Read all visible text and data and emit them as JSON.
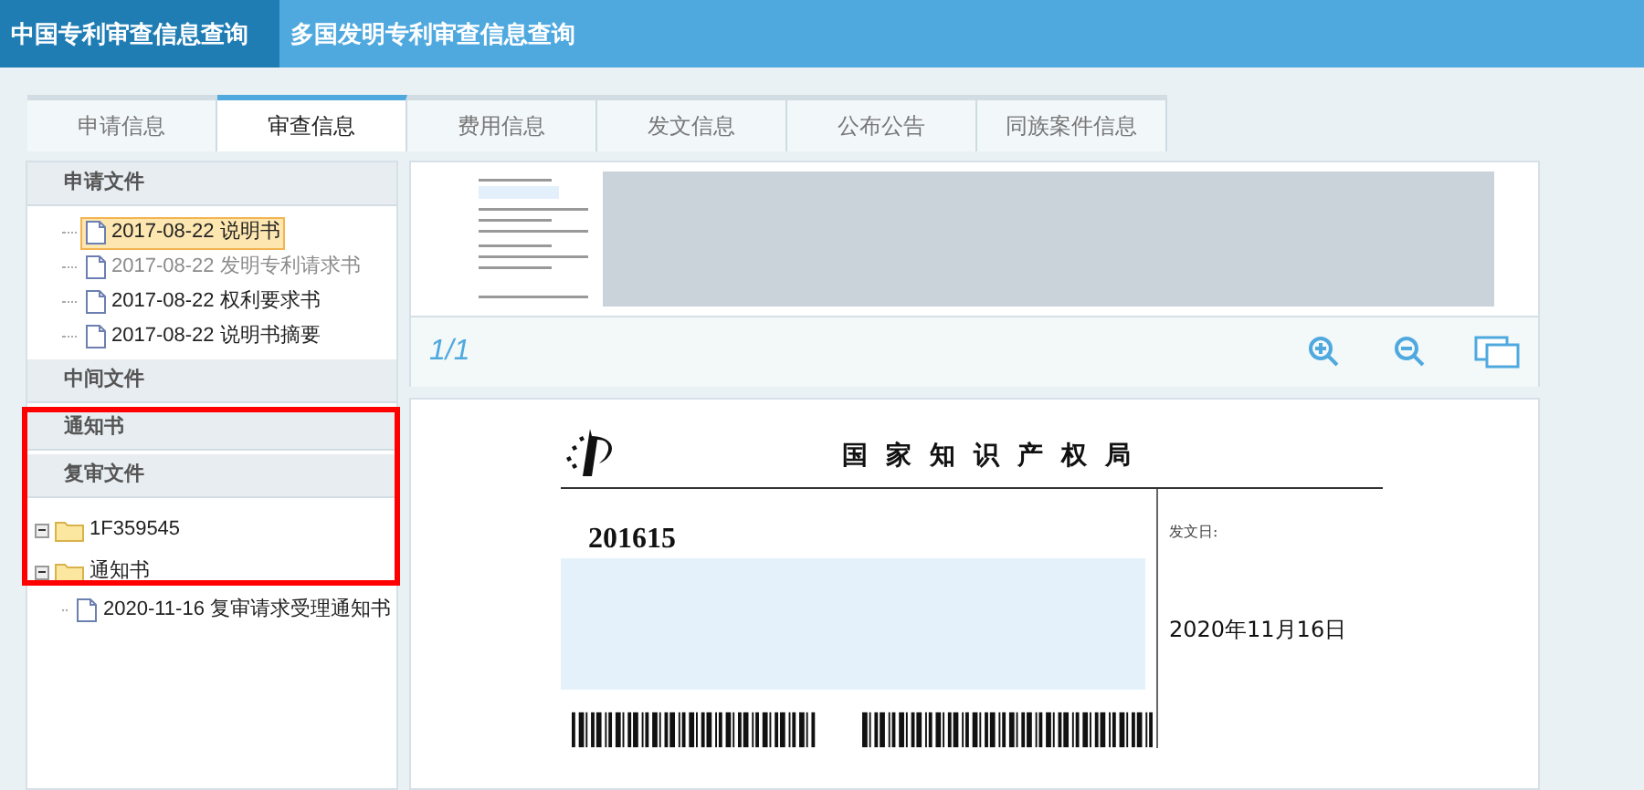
{
  "top_nav": [
    {
      "label": "中国专利审查信息查询",
      "selected": true
    },
    {
      "label": "多国发明专利审查信息查询",
      "selected": false
    }
  ],
  "tabs": [
    {
      "label": "申请信息",
      "selected": false
    },
    {
      "label": "审查信息",
      "selected": true
    },
    {
      "label": "费用信息",
      "selected": false
    },
    {
      "label": "发文信息",
      "selected": false
    },
    {
      "label": "公布公告",
      "selected": false
    },
    {
      "label": "同族案件信息",
      "selected": false
    }
  ],
  "sidebar": {
    "sections": [
      {
        "title": "申请文件",
        "items": [
          {
            "kind": "file",
            "label": "2017-08-22 说明书",
            "selected": true,
            "disabled": false
          },
          {
            "kind": "file",
            "label": "2017-08-22 发明专利请求书",
            "selected": false,
            "disabled": true
          },
          {
            "kind": "file",
            "label": "2017-08-22 权利要求书",
            "selected": false,
            "disabled": false
          },
          {
            "kind": "file",
            "label": "2017-08-22 说明书摘要",
            "selected": false,
            "disabled": false
          }
        ]
      },
      {
        "title": "中间文件"
      },
      {
        "title": "通知书"
      },
      {
        "title": "复审文件",
        "items": [
          {
            "kind": "folder",
            "label": "1F359545",
            "expanded": true
          },
          {
            "kind": "folder",
            "label": "通知书",
            "expanded": true,
            "children": [
              {
                "kind": "file",
                "label": "2020-11-16 复审请求受理通知书",
                "selected": false,
                "disabled": false
              }
            ]
          }
        ]
      }
    ]
  },
  "viewer": {
    "page_indicator": "1/1",
    "document": {
      "office": "国家知识产权局",
      "code": "201615",
      "date_label": "发文日:",
      "date": "2020年11月16日"
    }
  }
}
